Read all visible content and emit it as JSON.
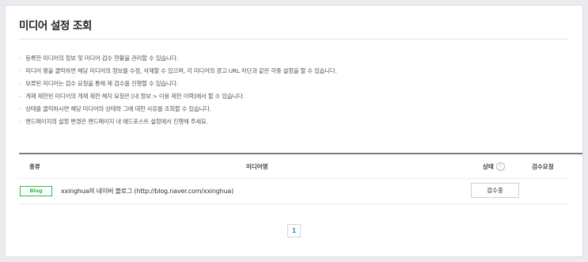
{
  "page": {
    "title": "미디어 설정 조회"
  },
  "notes": [
    "등록한 미디어의 정보 및 미디어 검수 현황을 관리할 수 있습니다.",
    "미디어 명을 클릭하면 해당 미디어의 정보를 수정, 삭제할 수 있으며, 각 미디어의 광고 URL 차단과 같은 각종 설정을 할 수 있습니다.",
    "보류된 미디어는 검수 요청을 통해 재 검수를 진행할 수 있습니다.",
    "게재 제한된 미디어의 게재 제한 해지 요청은 [내 정보 > 이용 제한 이력]에서 할 수 있습니다.",
    "상태를 클릭하시면 해당 미디어의 상태와 그에 대한 사유를 조회할 수 있습니다.",
    "밴드페이지의 설정 변경은 밴드페이지 내 애드포스트 설정에서 진행해 주세요."
  ],
  "table": {
    "headers": {
      "type": "종류",
      "name": "미디어명",
      "status": "상태",
      "status_help": "?",
      "request": "검수요청"
    },
    "rows": [
      {
        "type": "Blog",
        "name": "xxinghua의 네이버 블로그 (http://blog.naver.com/xxinghua)",
        "status": "검수중",
        "request": ""
      }
    ]
  },
  "pagination": {
    "current": "1"
  },
  "colors": {
    "badge_green": "#2fbb4f",
    "page_link_blue": "#2a8fd1"
  }
}
